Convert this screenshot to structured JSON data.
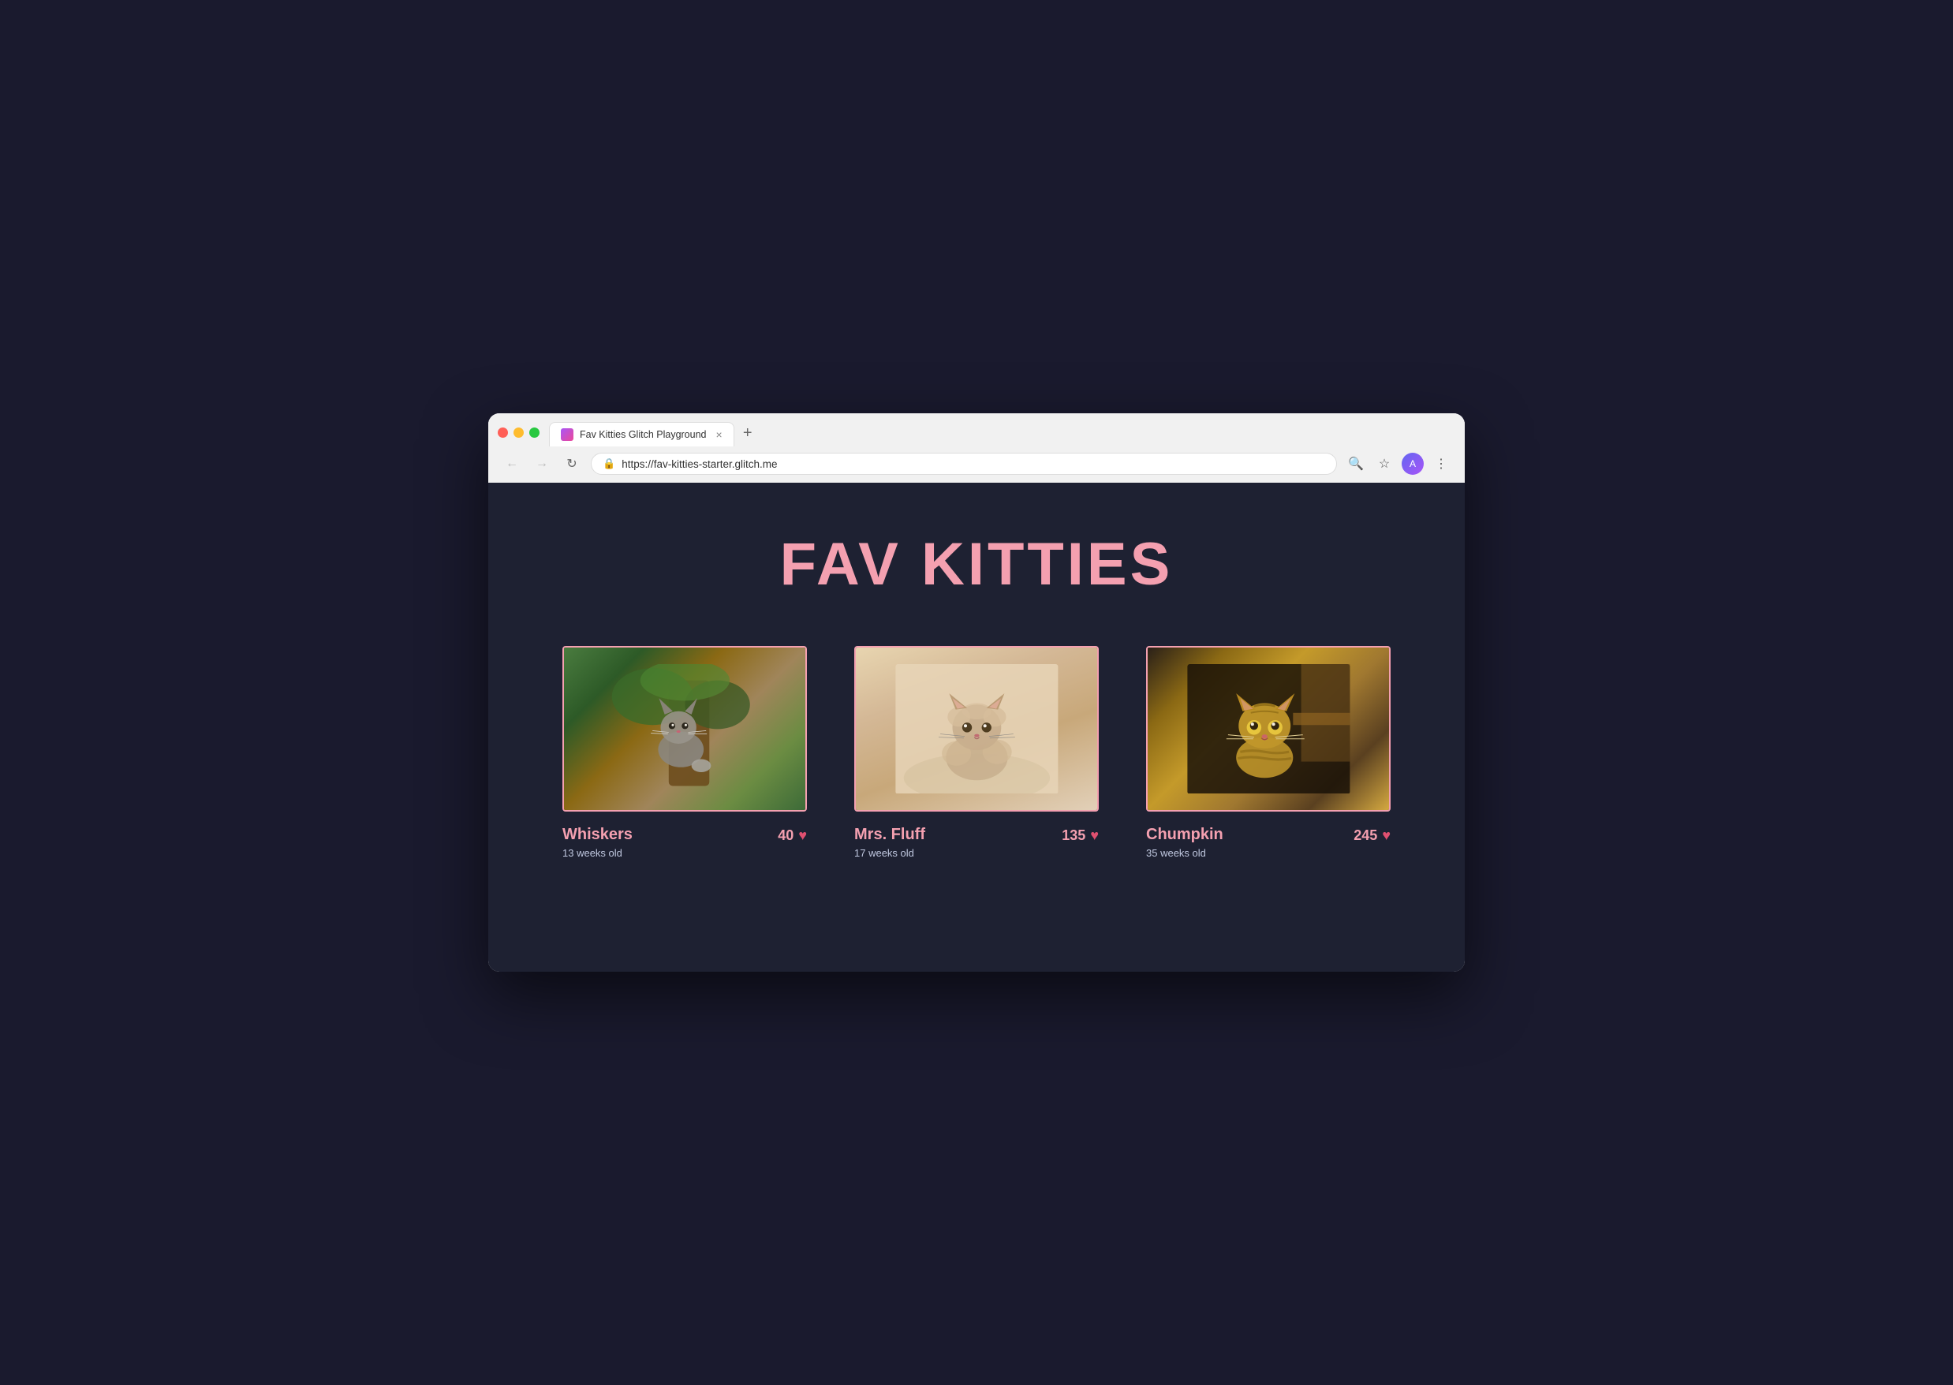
{
  "browser": {
    "tab": {
      "title": "Fav Kitties Glitch Playground",
      "close_label": "×",
      "new_tab_label": "+"
    },
    "nav": {
      "back_label": "←",
      "forward_label": "→",
      "reload_label": "↻",
      "url": "https://fav-kitties-starter.glitch.me"
    },
    "actions": {
      "search_label": "🔍",
      "bookmark_label": "☆",
      "menu_label": "⋮"
    }
  },
  "page": {
    "title": "FAV KITTIES",
    "cats": [
      {
        "id": "whiskers",
        "name": "Whiskers",
        "age": "13 weeks old",
        "votes": "40",
        "heart": "♥"
      },
      {
        "id": "mrs-fluff",
        "name": "Mrs. Fluff",
        "age": "17 weeks old",
        "votes": "135",
        "heart": "♥"
      },
      {
        "id": "chumpkin",
        "name": "Chumpkin",
        "age": "35 weeks old",
        "votes": "245",
        "heart": "♥"
      }
    ]
  }
}
